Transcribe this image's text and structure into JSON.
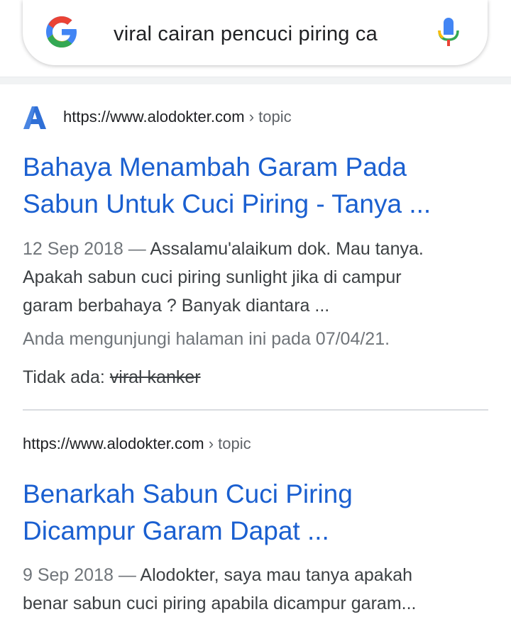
{
  "search": {
    "query": "viral cairan pencuci piring ca",
    "logo_icon": "google-g-icon",
    "mic_icon": "microphone-icon"
  },
  "results": [
    {
      "favicon": "A",
      "url": "https://www.alodokter.com",
      "breadcrumb": "› topic",
      "title_line1": "Bahaya Menambah Garam Pada",
      "title_line2": "Sabun Untuk Cuci Piring - Tanya ...",
      "date": "12 Sep 2018 —",
      "snippet_line1": "Assalamu'alaikum dok. Mau tanya.",
      "snippet_line2": "Apakah sabun cuci piring sunlight jika di campur",
      "snippet_line3": "garam berbahaya ? Banyak diantara ...",
      "visited": "Anda mengunjungi halaman ini pada 07/04/21.",
      "missing_label": "Tidak ada:",
      "missing_terms": "viral kanker"
    },
    {
      "url": "https://www.alodokter.com",
      "breadcrumb": "› topic",
      "title_line1": "Benarkah Sabun Cuci Piring",
      "title_line2": "Dicampur Garam Dapat ...",
      "date": "9 Sep 2018 —",
      "snippet_line1": "Alodokter, saya mau tanya apakah",
      "snippet_line2": "benar sabun cuci piring apabila dicampur garam..."
    }
  ],
  "colors": {
    "link": "#1a5fd0",
    "text": "#3c4043",
    "muted": "#70757a"
  }
}
